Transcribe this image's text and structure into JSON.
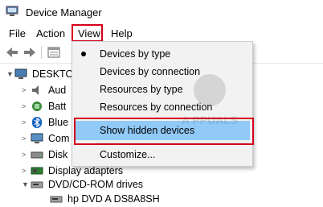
{
  "window": {
    "title": "Device Manager"
  },
  "menubar": {
    "items": [
      "File",
      "Action",
      "View",
      "Help"
    ]
  },
  "tree": {
    "root": "DESKTO",
    "rows": [
      {
        "label": "Aud",
        "icon": "audio-icon"
      },
      {
        "label": "Batt",
        "icon": "battery-icon"
      },
      {
        "label": "Blue",
        "icon": "bluetooth-icon"
      },
      {
        "label": "Com",
        "icon": "computer-icon"
      },
      {
        "label": "Disk",
        "icon": "disk-icon"
      },
      {
        "label": "Display adapters",
        "icon": "display-adapter-icon"
      },
      {
        "label": "DVD/CD-ROM drives",
        "icon": "dvd-drive-icon"
      },
      {
        "label": "hp DVD A   DS8A8SH",
        "icon": "dvd-icon"
      }
    ]
  },
  "view_menu": {
    "items": [
      {
        "label": "Devices by type",
        "checked": true
      },
      {
        "label": "Devices by connection"
      },
      {
        "label": "Resources by type"
      },
      {
        "label": "Resources by connection"
      },
      {
        "label": "Show hidden devices",
        "highlighted": true
      },
      {
        "label": "Customize..."
      }
    ]
  },
  "watermark": {
    "text": "APPUALS"
  },
  "colors": {
    "highlight_box": "#d6001c",
    "menu_hover": "#91c9f7",
    "menu_bg": "#f2f2f2"
  }
}
